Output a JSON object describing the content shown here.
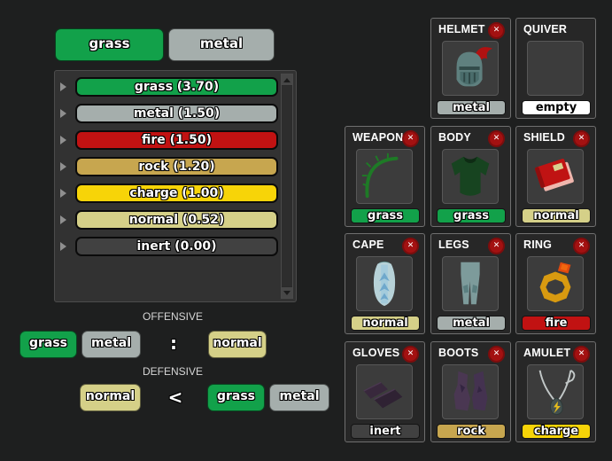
{
  "colors": {
    "background": "#1e1f1f",
    "panel": "#323232",
    "grass": "#12a14a",
    "metal": "#a5aeac",
    "fire": "#c11212",
    "rock": "#c7a64f",
    "charge": "#f7d408",
    "normal": "#d5d088",
    "inert": "#414141",
    "empty": "#ffffff",
    "remove_button": "#a31111"
  },
  "left": {
    "top_buttons": [
      {
        "label": "grass"
      },
      {
        "label": "metal"
      }
    ],
    "element_list": [
      {
        "name": "grass",
        "value": 3.7,
        "label": "grass (3.70)"
      },
      {
        "name": "metal",
        "value": 1.5,
        "label": "metal (1.50)"
      },
      {
        "name": "fire",
        "value": 1.5,
        "label": "fire (1.50)"
      },
      {
        "name": "rock",
        "value": 1.2,
        "label": "rock (1.20)"
      },
      {
        "name": "charge",
        "value": 1.0,
        "label": "charge (1.00)"
      },
      {
        "name": "normal",
        "value": 0.52,
        "label": "normal (0.52)"
      },
      {
        "name": "inert",
        "value": 0.0,
        "label": "inert (0.00)"
      }
    ],
    "offensive": {
      "heading": "OFFENSIVE",
      "attackers": [
        "grass",
        "metal"
      ],
      "separator": ":",
      "defenders": [
        "normal"
      ]
    },
    "defensive": {
      "heading": "DEFENSIVE",
      "defenders": [
        "normal"
      ],
      "separator": "<",
      "attackers": [
        "grass",
        "metal"
      ]
    }
  },
  "equipment": {
    "remove_label": "✕",
    "slots": [
      {
        "name": "HELMET",
        "element": "metal",
        "removable": true
      },
      {
        "name": "QUIVER",
        "element": "empty",
        "removable": false
      },
      {
        "name": "WEAPON",
        "element": "grass",
        "removable": true
      },
      {
        "name": "BODY",
        "element": "grass",
        "removable": true
      },
      {
        "name": "SHIELD",
        "element": "normal",
        "removable": true
      },
      {
        "name": "CAPE",
        "element": "normal",
        "removable": true
      },
      {
        "name": "LEGS",
        "element": "metal",
        "removable": true
      },
      {
        "name": "RING",
        "element": "fire",
        "removable": true
      },
      {
        "name": "GLOVES",
        "element": "inert",
        "removable": true
      },
      {
        "name": "BOOTS",
        "element": "rock",
        "removable": true
      },
      {
        "name": "AMULET",
        "element": "charge",
        "removable": true
      }
    ]
  }
}
